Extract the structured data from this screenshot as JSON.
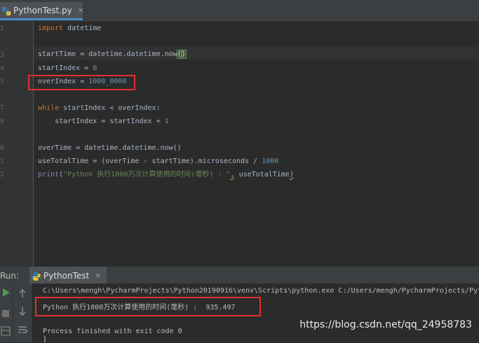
{
  "tab": {
    "filename": "PythonTest.py",
    "close": "×"
  },
  "gutter": {
    "lines": [
      "1",
      "",
      "3",
      "4",
      "5",
      "",
      "7",
      "8",
      "",
      "0",
      "1",
      "2"
    ]
  },
  "code": {
    "l1": {
      "kw": "import",
      "rest": " datetime"
    },
    "l3": {
      "text": "startTime = datetime.datetime.now",
      "open": "(",
      "close": ")"
    },
    "l4": {
      "text": "startIndex = ",
      "num": "0"
    },
    "l5": {
      "text": "overIndex = ",
      "num": "1000_0000"
    },
    "l7": {
      "kw": "while",
      "rest": " startIndex < overIndex:"
    },
    "l8": {
      "text": "    startIndex = startIndex + ",
      "num": "1"
    },
    "l10": {
      "text": "overTime = datetime.datetime.now()"
    },
    "l11": {
      "text": "useTotalTime = (overTime - startTime).microseconds / ",
      "num": "1000"
    },
    "l12": {
      "fn": "print",
      "open": "(",
      "str": "\"Python 执行1000万次计算使用的时间(毫秒) : \"",
      "comma": ",",
      "rest": " useTotalTime",
      "close": ")"
    }
  },
  "run": {
    "label": "Run:",
    "tab": "PythonTest",
    "close": "×",
    "output": {
      "cmd": "C:\\Users\\mengh\\PycharmProjects\\Python20190916\\venv\\Scripts\\python.exe C:/Users/mengh/PycharmProjects/Pyt",
      "result": "Python 执行1000万次计算使用的时间(毫秒) :  935.497",
      "exit": "Process finished with exit code 0",
      "cursor": "|"
    }
  },
  "watermark": "https://blog.csdn.net/qq_24958783",
  "colors": {
    "keyword": "#cc7832",
    "number": "#6897bb",
    "string": "#6a8759",
    "builtin": "#8888c6",
    "highlight_box": "#e0312f"
  }
}
